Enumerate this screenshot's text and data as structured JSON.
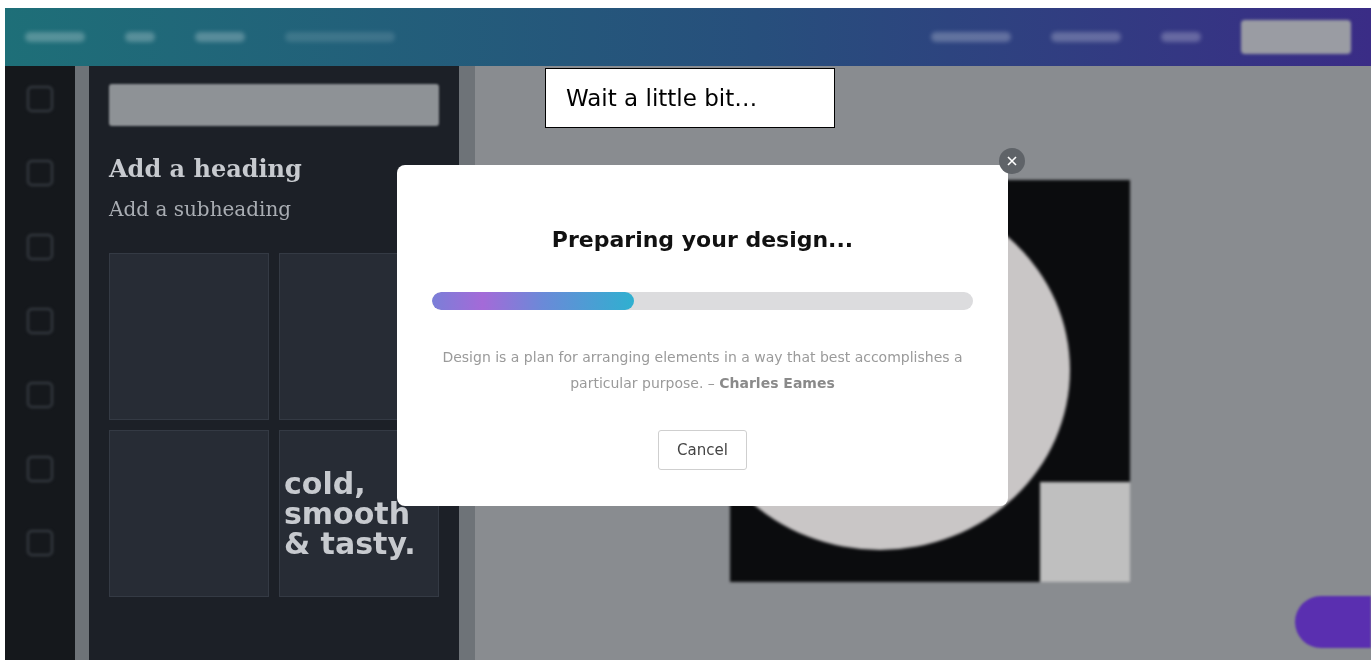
{
  "editor_panel": {
    "heading": "Add a heading",
    "subheading": "Add a subheading",
    "sample_text": "cold, smooth & tasty."
  },
  "callout": {
    "text": "Wait a little bit…"
  },
  "dialog": {
    "title": "Preparing your design...",
    "progress": {
      "level": 0.373
    },
    "quote": "Design is a plan for arranging elements in a way that best accomplishes a particular purpose. – **Charles Eames**",
    "buttons": [
      {
        "label": "Cancel"
      }
    ]
  }
}
